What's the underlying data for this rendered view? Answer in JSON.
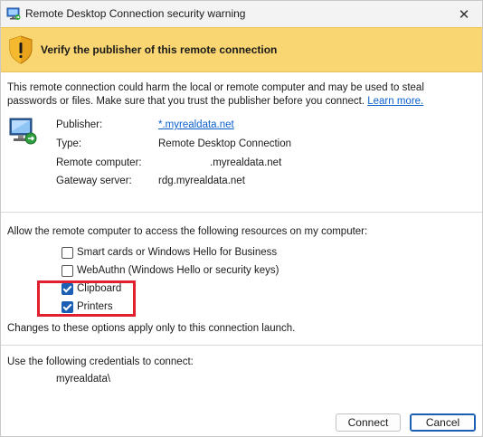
{
  "window": {
    "title": "Remote Desktop Connection security warning",
    "close_glyph": "✕"
  },
  "banner": {
    "text": "Verify the publisher of this remote connection",
    "icon": "warning-shield-icon",
    "color": "#f9d671"
  },
  "description": {
    "text": "This remote connection could harm the local or remote computer and may be used to steal passwords or files. Make sure that you trust the publisher before you connect. ",
    "link_text": "Learn more."
  },
  "details": {
    "publisher_label": "Publisher:",
    "publisher_value": "*.myrealdata.net",
    "type_label": "Type:",
    "type_value": "Remote Desktop Connection",
    "remote_computer_label": "Remote computer:",
    "remote_computer_value": ".myrealdata.net",
    "gateway_label": "Gateway server:",
    "gateway_value": "rdg.myrealdata.net"
  },
  "resources": {
    "heading": "Allow the remote computer to access the following resources on my computer:",
    "items": [
      {
        "label": "Smart cards or Windows Hello for Business",
        "checked": false
      },
      {
        "label": "WebAuthn (Windows Hello or security keys)",
        "checked": false
      },
      {
        "label": "Clipboard",
        "checked": true
      },
      {
        "label": "Printers",
        "checked": true
      }
    ],
    "note": "Changes to these options apply only to this connection launch."
  },
  "credentials": {
    "heading": "Use the following credentials to connect:",
    "value": "myrealdata\\"
  },
  "buttons": {
    "connect": "Connect",
    "cancel": "Cancel"
  },
  "colors": {
    "accent": "#1a5fb4",
    "highlight": "#e0202f",
    "link": "#0b5fcc"
  }
}
